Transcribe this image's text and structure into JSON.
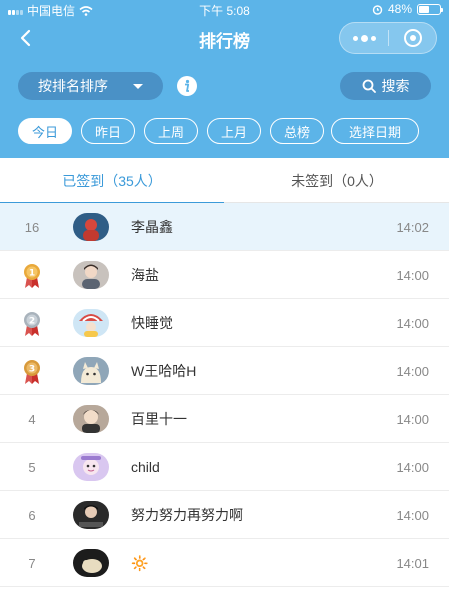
{
  "status_bar": {
    "carrier": "中国电信",
    "time": "下午 5:08",
    "battery": "48%"
  },
  "nav": {
    "title": "排行榜"
  },
  "toolbar": {
    "sort_label": "按排名排序",
    "search_label": "搜索"
  },
  "date_filters": [
    "今日",
    "昨日",
    "上周",
    "上月",
    "总榜",
    "选择日期"
  ],
  "tabs": [
    {
      "label": "已签到（35人）"
    },
    {
      "label": "未签到（0人）"
    }
  ],
  "colors": {
    "header": "#5cb4e8",
    "accent": "#3b9ad9",
    "highlight_row": "#e8f4fc",
    "gold": "#e9a93b",
    "silver": "#a9b3bc",
    "bronze": "#d89a3b"
  },
  "entries": [
    {
      "rank": "16",
      "name": "李晶鑫",
      "time": "14:02"
    },
    {
      "rank": "1",
      "name": "海盐",
      "time": "14:00",
      "medal": "gold"
    },
    {
      "rank": "2",
      "name": "快睡觉",
      "time": "14:00",
      "medal": "silver"
    },
    {
      "rank": "3",
      "name": "W王哈哈H",
      "time": "14:00",
      "medal": "bronze"
    },
    {
      "rank": "4",
      "name": "百里十一",
      "time": "14:00"
    },
    {
      "rank": "5",
      "name": "child",
      "time": "14:00"
    },
    {
      "rank": "6",
      "name": "努力努力再努力啊",
      "time": "14:00"
    },
    {
      "rank": "7",
      "name": "🔆",
      "time": "14:01"
    }
  ]
}
